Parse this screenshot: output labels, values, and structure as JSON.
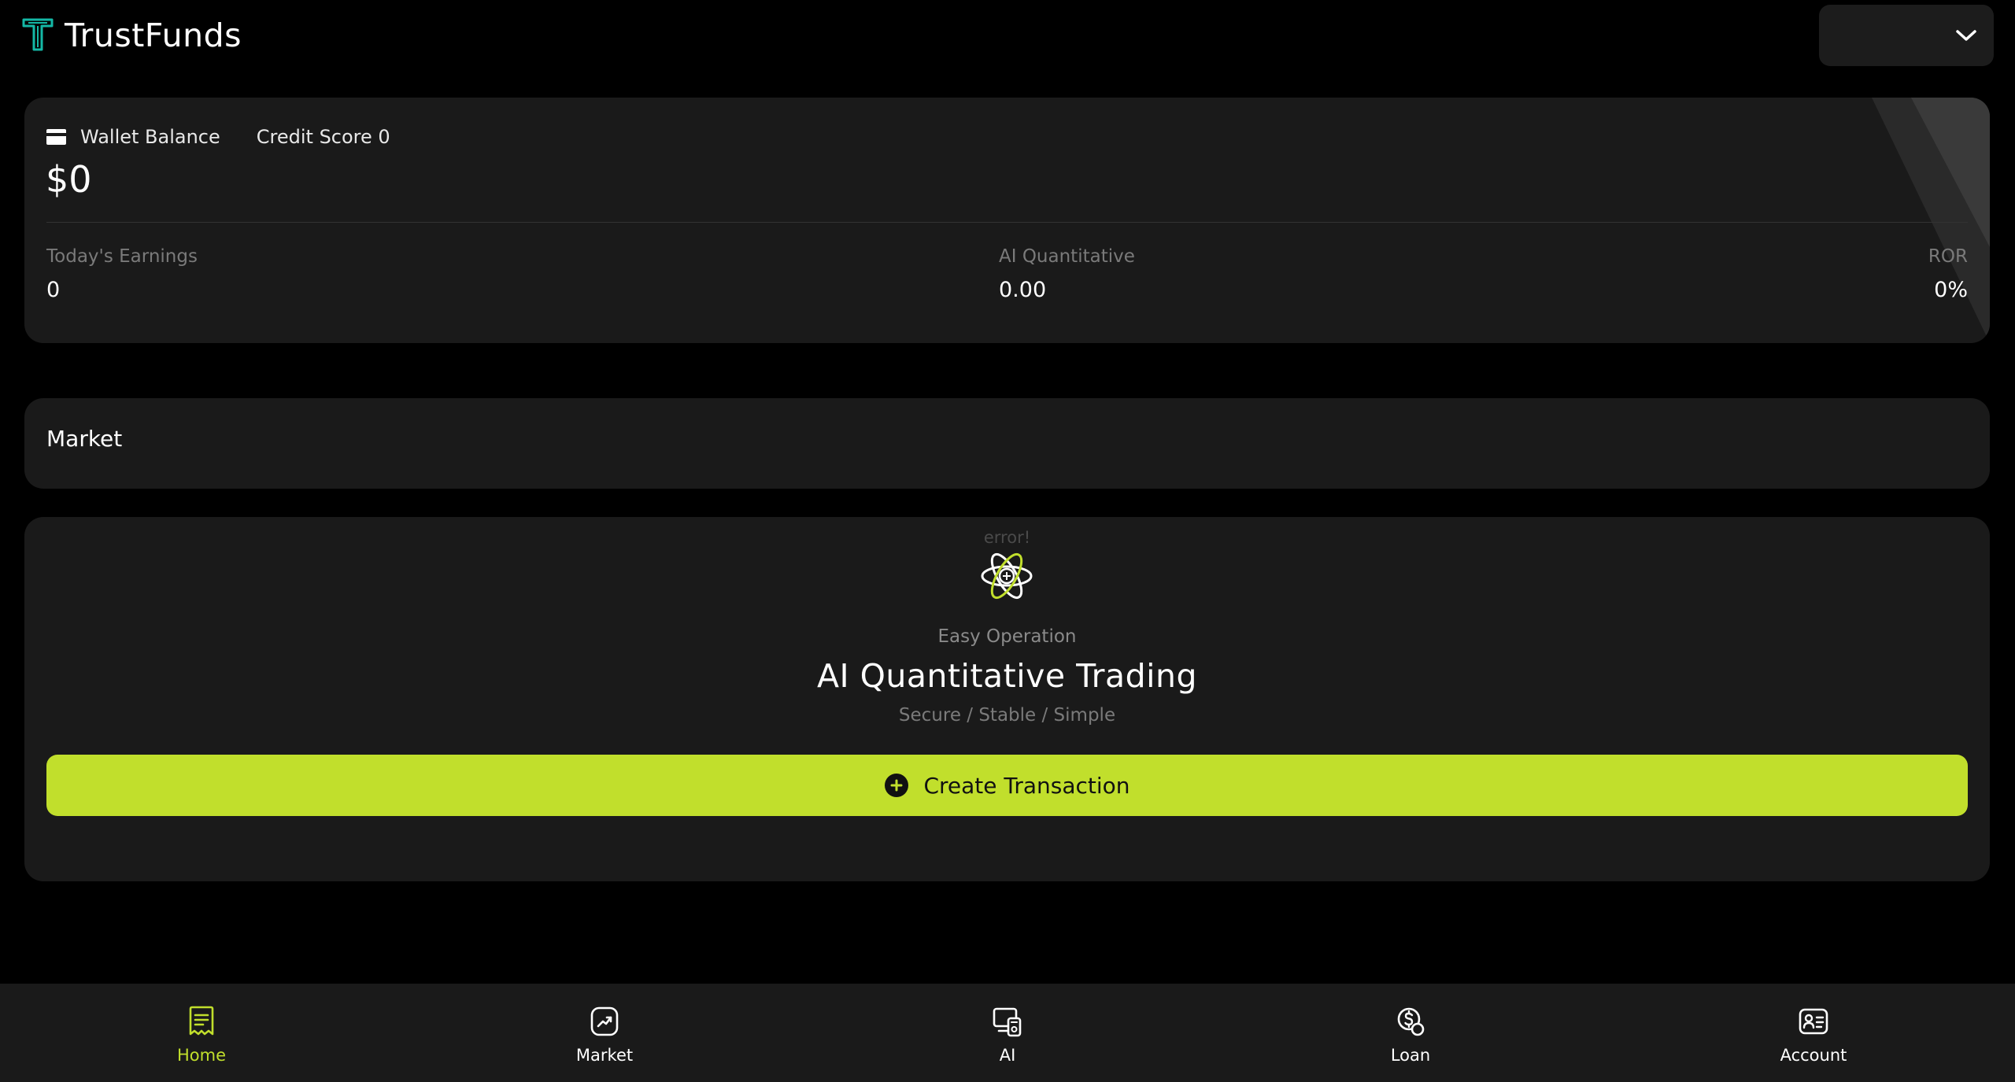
{
  "header": {
    "brand": "TrustFunds",
    "logo_icon": "trustfunds-logo",
    "selector_icon": "chevron-down-icon"
  },
  "balance_card": {
    "wallet_label": "Wallet Balance",
    "credit_label": "Credit Score 0",
    "balance": "$0",
    "stats": {
      "earnings": {
        "label": "Today's Earnings",
        "value": "0"
      },
      "ai_quant": {
        "label": "AI Quantitative",
        "value": "0.00"
      },
      "ror": {
        "label": "ROR",
        "value": "0%"
      }
    }
  },
  "market": {
    "title": "Market"
  },
  "ai_card": {
    "error_text": "error!",
    "eyebrow": "Easy Operation",
    "title": "AI Quantitative Trading",
    "subtitle": "Secure / Stable / Simple",
    "button_label": "Create Transaction"
  },
  "nav": {
    "items": [
      {
        "label": "Home",
        "icon": "receipt-icon",
        "active": true
      },
      {
        "label": "Market",
        "icon": "chart-trend-icon",
        "active": false
      },
      {
        "label": "AI",
        "icon": "ai-device-icon",
        "active": false
      },
      {
        "label": "Loan",
        "icon": "coin-icon",
        "active": false
      },
      {
        "label": "Account",
        "icon": "id-card-icon",
        "active": false
      }
    ]
  },
  "colors": {
    "accent": "#c1df2c",
    "background": "#000000",
    "card": "#1a1a1a",
    "logo": "#14b8a6"
  }
}
